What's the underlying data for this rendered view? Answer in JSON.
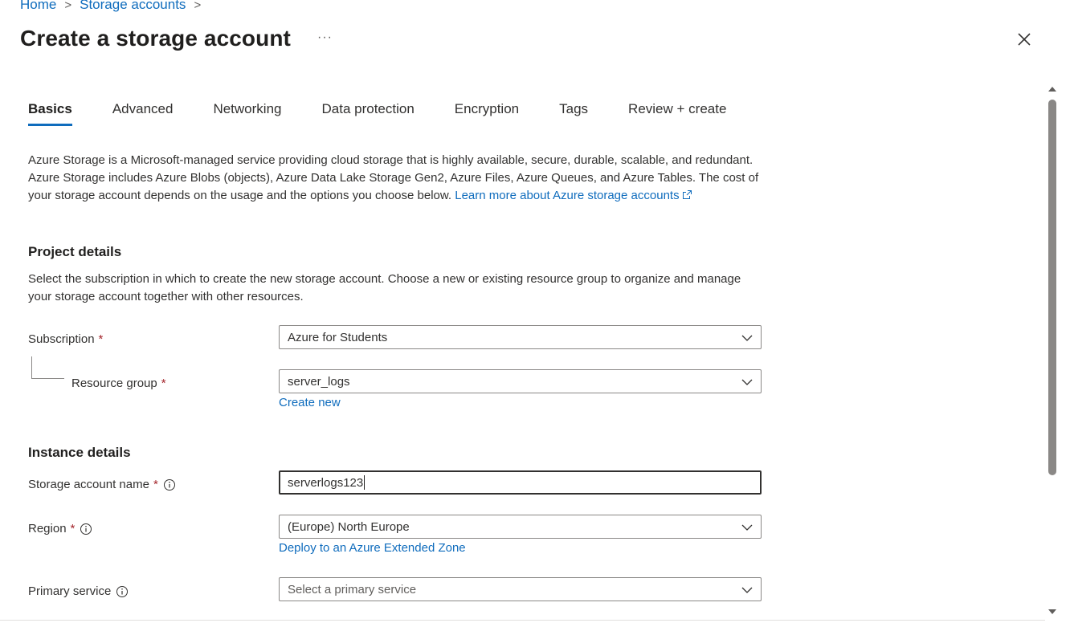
{
  "breadcrumb": {
    "items": [
      "Home",
      "Storage accounts"
    ]
  },
  "header": {
    "title": "Create a storage account",
    "more": "···"
  },
  "tabs": [
    "Basics",
    "Advanced",
    "Networking",
    "Data protection",
    "Encryption",
    "Tags",
    "Review + create"
  ],
  "intro": {
    "text": "Azure Storage is a Microsoft-managed service providing cloud storage that is highly available, secure, durable, scalable, and redundant. Azure Storage includes Azure Blobs (objects), Azure Data Lake Storage Gen2, Azure Files, Azure Queues, and Azure Tables. The cost of your storage account depends on the usage and the options you choose below.",
    "link": "Learn more about Azure storage accounts"
  },
  "project": {
    "heading": "Project details",
    "description": "Select the subscription in which to create the new storage account. Choose a new or existing resource group to organize and manage your storage account together with other resources.",
    "subscription_label": "Subscription",
    "subscription_value": "Azure for Students",
    "resource_group_label": "Resource group",
    "resource_group_value": "server_logs",
    "create_new": "Create new"
  },
  "instance": {
    "heading": "Instance details",
    "name_label": "Storage account name",
    "name_value": "serverlogs123",
    "region_label": "Region",
    "region_value": "(Europe) North Europe",
    "region_link": "Deploy to an Azure Extended Zone",
    "primary_label": "Primary service",
    "primary_placeholder": "Select a primary service"
  },
  "required_mark": "*",
  "colors": {
    "accent": "#0f6cbd",
    "required": "#a4262c",
    "text": "#323130"
  }
}
